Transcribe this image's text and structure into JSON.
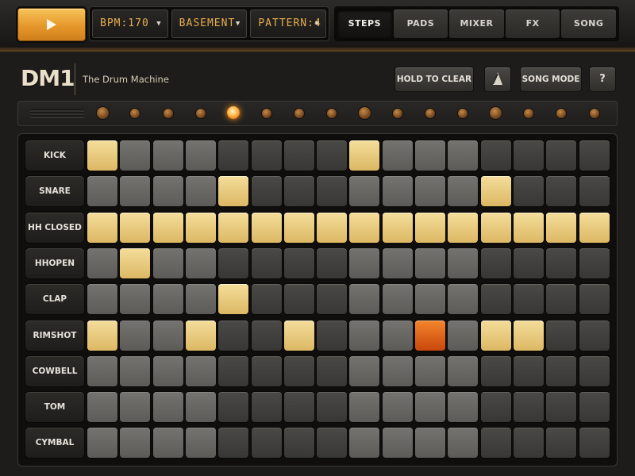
{
  "transport": {
    "play_label": "play"
  },
  "selectors": [
    {
      "value": "BPM:170"
    },
    {
      "value": "BASEMENT"
    },
    {
      "value": "PATTERN:4"
    }
  ],
  "tabs": [
    {
      "label": "STEPS",
      "active": true
    },
    {
      "label": "PADS",
      "active": false
    },
    {
      "label": "MIXER",
      "active": false
    },
    {
      "label": "FX",
      "active": false
    },
    {
      "label": "SONG",
      "active": false
    }
  ],
  "header": {
    "logo": "DM1",
    "subtitle": "The Drum Machine",
    "hold_to_clear": "HOLD TO CLEAR",
    "song_mode": "SONG MODE",
    "help": "?"
  },
  "steps": {
    "count": 16,
    "current_step": 5
  },
  "icons": [
    "play-icon",
    "metronome-icon",
    "chevron-down-icon"
  ],
  "colors": {
    "accent": "#e6972a",
    "active_step": "#dcb864",
    "current_step": "#e1601a"
  },
  "tracks": [
    {
      "name": "KICK",
      "steps": [
        1,
        0,
        0,
        0,
        0,
        0,
        0,
        0,
        1,
        0,
        0,
        0,
        0,
        0,
        0,
        0
      ]
    },
    {
      "name": "SNARE",
      "steps": [
        0,
        0,
        0,
        0,
        1,
        0,
        0,
        0,
        0,
        0,
        0,
        0,
        1,
        0,
        0,
        0
      ]
    },
    {
      "name": "HH CLOSED",
      "steps": [
        1,
        1,
        1,
        1,
        1,
        1,
        1,
        1,
        1,
        1,
        1,
        1,
        1,
        1,
        1,
        1
      ]
    },
    {
      "name": "HHOPEN",
      "steps": [
        0,
        1,
        0,
        0,
        0,
        0,
        0,
        0,
        0,
        0,
        0,
        0,
        0,
        0,
        0,
        0
      ]
    },
    {
      "name": "CLAP",
      "steps": [
        0,
        0,
        0,
        0,
        1,
        0,
        0,
        0,
        0,
        0,
        0,
        0,
        0,
        0,
        0,
        0
      ]
    },
    {
      "name": "RIMSHOT",
      "steps": [
        1,
        0,
        0,
        1,
        0,
        0,
        1,
        0,
        0,
        0,
        2,
        0,
        1,
        1,
        0,
        0
      ]
    },
    {
      "name": "COWBELL",
      "steps": [
        0,
        0,
        0,
        0,
        0,
        0,
        0,
        0,
        0,
        0,
        0,
        0,
        0,
        0,
        0,
        0
      ]
    },
    {
      "name": "TOM",
      "steps": [
        0,
        0,
        0,
        0,
        0,
        0,
        0,
        0,
        0,
        0,
        0,
        0,
        0,
        0,
        0,
        0
      ]
    },
    {
      "name": "CYMBAL",
      "steps": [
        0,
        0,
        0,
        0,
        0,
        0,
        0,
        0,
        0,
        0,
        0,
        0,
        0,
        0,
        0,
        0
      ]
    }
  ]
}
